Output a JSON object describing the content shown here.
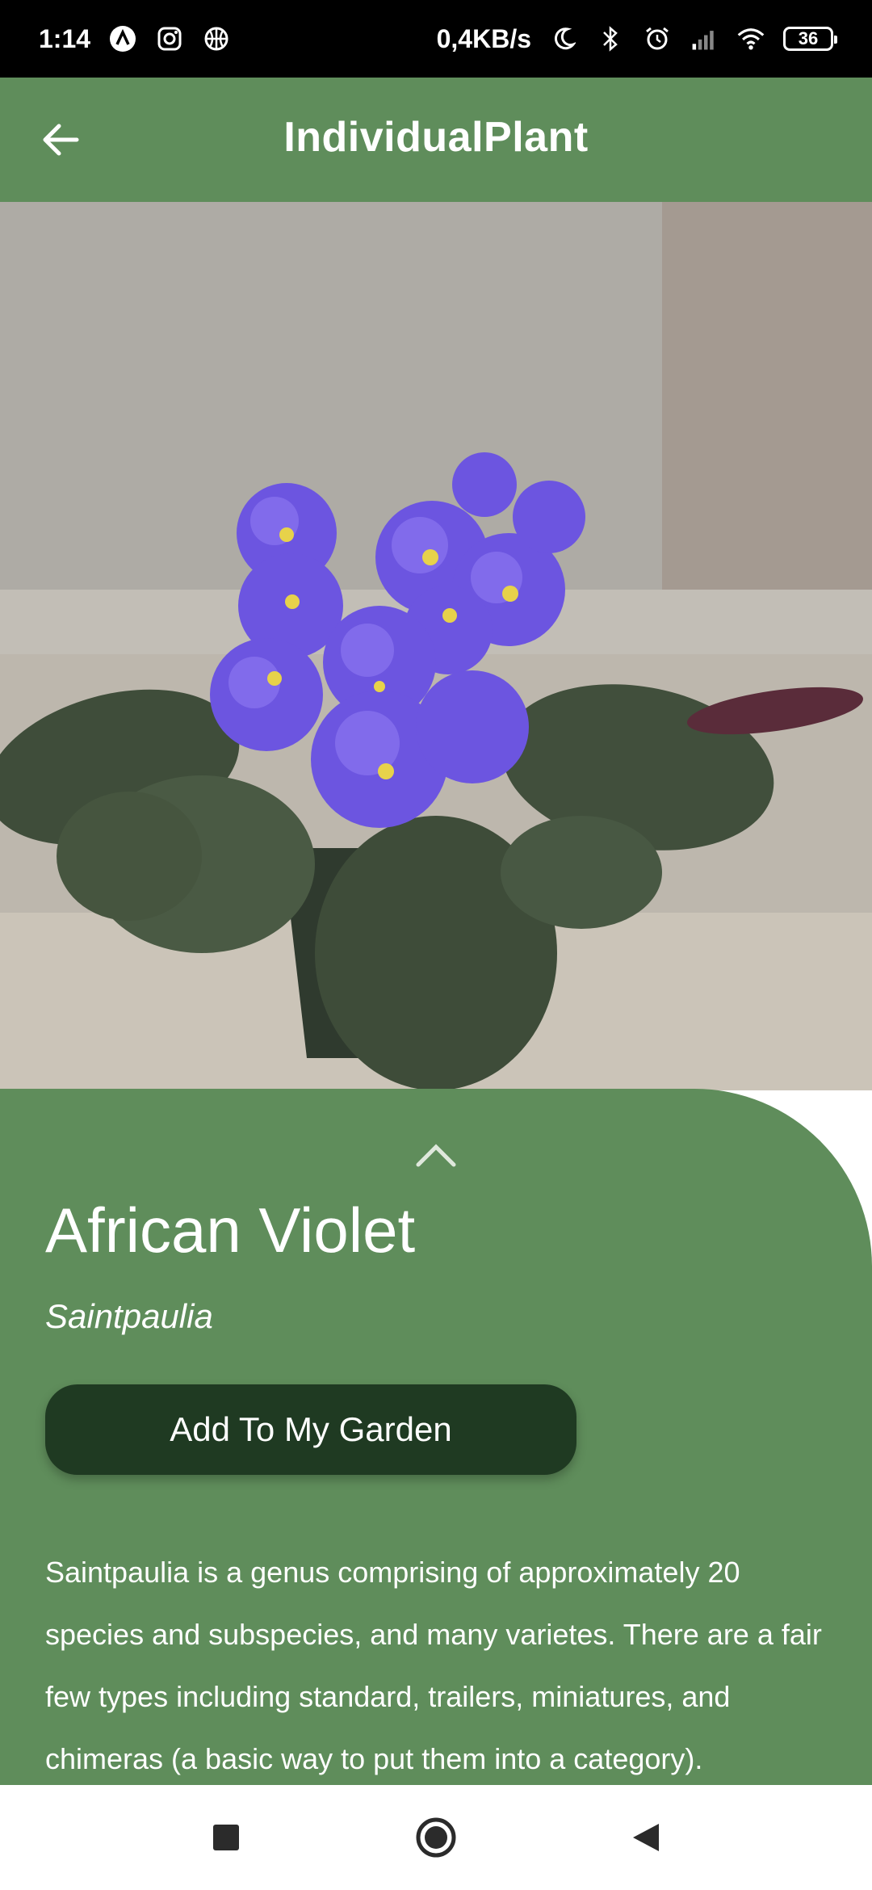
{
  "status_bar": {
    "time": "1:14",
    "speed": "0,4KB/s",
    "battery": "36"
  },
  "app_bar": {
    "title": "IndividualPlant",
    "back_icon": "arrow-left-icon"
  },
  "plant": {
    "name": "African Violet",
    "scientific_name": "Saintpaulia",
    "add_button": "Add To My Garden",
    "description": " Saintpaulia is a genus comprising of approximately 20 species and subspecies, and many varietes. There are a fair few types including standard, trailers, miniatures, and chimeras (a basic way to put them into a category)."
  },
  "colors": {
    "primary": "#5f8d5b",
    "button": "#1f3a22",
    "status_bar": "#000000"
  },
  "nav": {
    "recent_icon": "square-icon",
    "home_icon": "circle-icon",
    "back_icon": "triangle-back-icon"
  }
}
